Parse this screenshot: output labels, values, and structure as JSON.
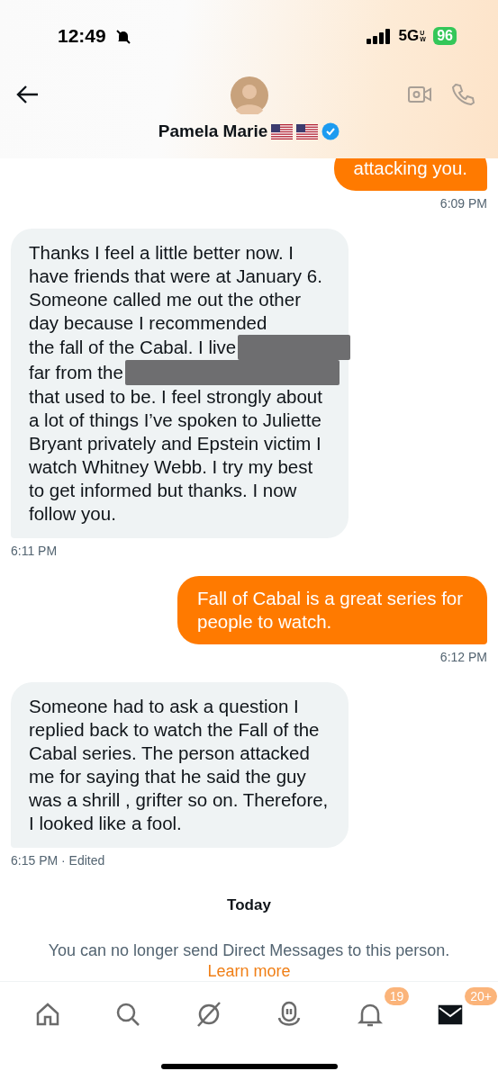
{
  "status_bar": {
    "time": "12:49",
    "network": "5G",
    "network_sub": "UW",
    "battery": "96"
  },
  "header": {
    "name": "Pamela Marie",
    "badges": [
      {
        "kind": "flag"
      },
      {
        "kind": "flag"
      },
      {
        "kind": "verified"
      }
    ]
  },
  "messages": [
    {
      "kind": "sent",
      "parts": [
        {
          "kind": "text",
          "text": "attacking you."
        }
      ],
      "time": "6:09 PM"
    },
    {
      "kind": "received",
      "parts": [
        {
          "kind": "text",
          "text": "Thanks I feel a little better now. I have friends that were at January 6. Someone called me out the other day because I recommended"
        },
        {
          "kind": "text",
          "text": "the fall of the Cabal. I live"
        },
        {
          "kind": "redacted"
        },
        {
          "kind": "text",
          "text": "far from the"
        },
        {
          "kind": "redacted"
        },
        {
          "kind": "text",
          "text": "that used to be. I feel strongly about a lot of things I’ve spoken to Juliette Bryant privately and Epstein victim I watch Whitney Webb. I try my best to get informed but thanks. I now follow you."
        }
      ],
      "time": "6:11 PM"
    },
    {
      "kind": "sent",
      "parts": [
        {
          "kind": "text",
          "text": "Fall of Cabal is a great series for people to watch."
        }
      ],
      "time": "6:12 PM"
    },
    {
      "kind": "received",
      "parts": [
        {
          "kind": "text",
          "text": "Someone had to ask a question I replied back to watch the Fall of the Cabal series. The person attacked me for saying that he said the guy was a shrill , grifter so on. Therefore, I looked like a fool."
        }
      ],
      "time": "6:15 PM · Edited"
    }
  ],
  "day_label": "Today",
  "notice": {
    "text": "You can no longer send Direct Messages to this person.",
    "link": "Learn more"
  },
  "nav": [
    {
      "kind": "home",
      "selected": false
    },
    {
      "kind": "search",
      "selected": false
    },
    {
      "kind": "grok",
      "selected": false
    },
    {
      "kind": "spaces",
      "selected": false
    },
    {
      "kind": "notifications",
      "selected": false,
      "badge": "19"
    },
    {
      "kind": "messages",
      "selected": true,
      "badge": "20+"
    }
  ]
}
